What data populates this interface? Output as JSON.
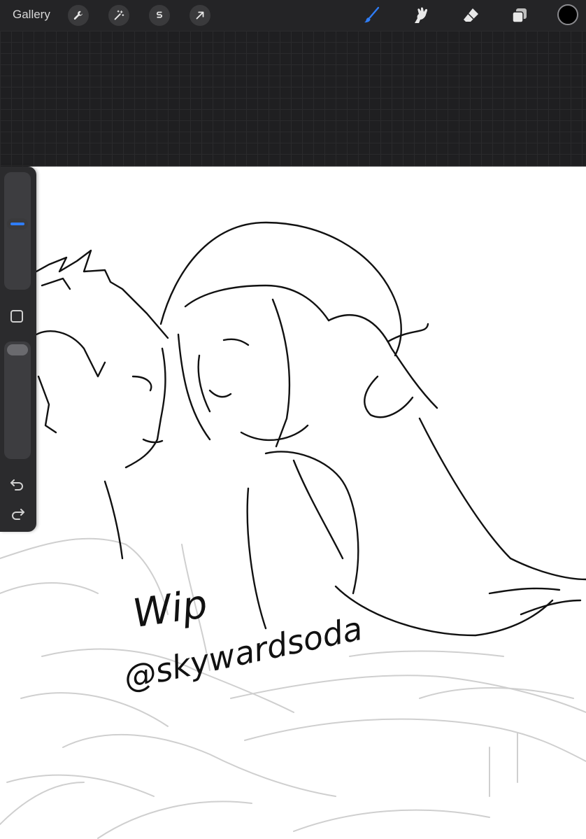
{
  "toolbar": {
    "gallery_label": "Gallery",
    "left_tools": [
      {
        "name": "actions",
        "icon": "wrench-icon"
      },
      {
        "name": "adjustments",
        "icon": "magic-wand-icon"
      },
      {
        "name": "selection",
        "icon": "selection-s-icon"
      },
      {
        "name": "transform",
        "icon": "arrow-cursor-icon"
      }
    ],
    "right_tools": [
      {
        "name": "brush",
        "icon": "brush-icon",
        "active": true,
        "color": "#2f7df6"
      },
      {
        "name": "smudge",
        "icon": "smudge-icon"
      },
      {
        "name": "eraser",
        "icon": "eraser-icon"
      },
      {
        "name": "layers",
        "icon": "layers-icon"
      }
    ],
    "current_color": "#000000"
  },
  "sidebar": {
    "brush_size_level": 0.62,
    "opacity_level": 0.95,
    "modify_button_icon": "square-icon",
    "undo_icon": "undo-icon",
    "redo_icon": "redo-icon"
  },
  "canvas": {
    "text_line_1": "Wip",
    "text_line_2": "@skywardsoda"
  }
}
